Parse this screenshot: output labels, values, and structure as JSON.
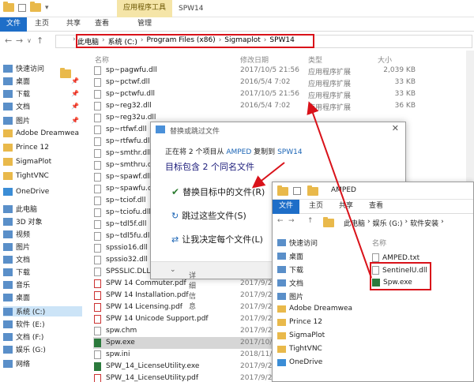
{
  "window": {
    "title": "SPW14",
    "context_tab_group": "应用程序工具",
    "ribbon_tabs": [
      "文件",
      "主页",
      "共享",
      "查看",
      "管理"
    ]
  },
  "address": {
    "crumbs": [
      "此电脑",
      "系统 (C:)",
      "Program Files (x86)",
      "Sigmaplot",
      "SPW14"
    ],
    "highlight_color": "#d9121a"
  },
  "columns": {
    "name": "名称",
    "date": "修改日期",
    "type": "类型",
    "size": "大小"
  },
  "sidebar": [
    {
      "label": "快速访问",
      "icon": "star-icon",
      "pinned": false
    },
    {
      "label": "桌面",
      "icon": "desktop-icon",
      "pinned": true
    },
    {
      "label": "下载",
      "icon": "download-icon",
      "pinned": true
    },
    {
      "label": "文档",
      "icon": "document-icon",
      "pinned": true
    },
    {
      "label": "图片",
      "icon": "picture-icon",
      "pinned": true
    },
    {
      "label": "Adobe Dreamwea",
      "icon": "folder-icon",
      "pinned": false
    },
    {
      "label": "Prince 12",
      "icon": "folder-icon",
      "pinned": false
    },
    {
      "label": "SigmaPlot",
      "icon": "folder-icon",
      "pinned": false
    },
    {
      "label": "TightVNC",
      "icon": "folder-icon",
      "pinned": false
    },
    {
      "label": "OneDrive",
      "icon": "cloud-icon",
      "pinned": false
    },
    {
      "label": "此电脑",
      "icon": "computer-icon",
      "pinned": false
    },
    {
      "label": "3D 对象",
      "icon": "cube-icon",
      "pinned": false
    },
    {
      "label": "视频",
      "icon": "video-icon",
      "pinned": false
    },
    {
      "label": "图片",
      "icon": "picture-icon",
      "pinned": false
    },
    {
      "label": "文档",
      "icon": "document-icon",
      "pinned": false
    },
    {
      "label": "下载",
      "icon": "download-icon",
      "pinned": false
    },
    {
      "label": "音乐",
      "icon": "music-icon",
      "pinned": false
    },
    {
      "label": "桌面",
      "icon": "desktop-icon",
      "pinned": false
    },
    {
      "label": "系统 (C:)",
      "icon": "drive-icon",
      "pinned": false,
      "selected": true
    },
    {
      "label": "软件 (E:)",
      "icon": "drive-icon",
      "pinned": false
    },
    {
      "label": "文档 (F:)",
      "icon": "drive-icon",
      "pinned": false
    },
    {
      "label": "娱乐 (G:)",
      "icon": "drive-icon",
      "pinned": false
    },
    {
      "label": "网络",
      "icon": "network-icon",
      "pinned": false
    }
  ],
  "files": [
    {
      "name": "sp~pagwfu.dll",
      "date": "2017/10/5 21:56",
      "type": "应用程序扩展",
      "size": "2,039 KB"
    },
    {
      "name": "sp~pctwf.dll",
      "date": "2016/5/4 7:02",
      "type": "应用程序扩展",
      "size": "33 KB"
    },
    {
      "name": "sp~pctwfu.dll",
      "date": "2017/10/5 21:56",
      "type": "应用程序扩展",
      "size": "33 KB"
    },
    {
      "name": "sp~reg32.dll",
      "date": "2016/5/4 7:02",
      "type": "应用程序扩展",
      "size": "36 KB"
    },
    {
      "name": "sp~reg32u.dll",
      "date": "",
      "type": "",
      "size": ""
    },
    {
      "name": "sp~rtfwf.dll",
      "date": "",
      "type": "",
      "size": ""
    },
    {
      "name": "sp~rtfwfu.dll",
      "date": "",
      "type": "",
      "size": ""
    },
    {
      "name": "sp~smthr.dll",
      "date": "",
      "type": "",
      "size": ""
    },
    {
      "name": "sp~smthru.dll",
      "date": "",
      "type": "",
      "size": ""
    },
    {
      "name": "sp~spawf.dll",
      "date": "",
      "type": "",
      "size": ""
    },
    {
      "name": "sp~spawfu.dll",
      "date": "",
      "type": "",
      "size": ""
    },
    {
      "name": "sp~tciof.dll",
      "date": "",
      "type": "",
      "size": ""
    },
    {
      "name": "sp~tciofu.dll",
      "date": "",
      "type": "",
      "size": ""
    },
    {
      "name": "sp~tdl5f.dll",
      "date": "",
      "type": "",
      "size": ""
    },
    {
      "name": "sp~tdl5fu.dll",
      "date": "",
      "type": "",
      "size": ""
    },
    {
      "name": "spssio16.dll",
      "date": "",
      "type": "",
      "size": ""
    },
    {
      "name": "spssio32.dll",
      "date": "",
      "type": "",
      "size": ""
    },
    {
      "name": "SPSSLIC.DLL",
      "date": "",
      "type": "",
      "size": ""
    },
    {
      "name": "SPW 14 Commuter.pdf",
      "date": "2017/9/2",
      "type": "",
      "size": ""
    },
    {
      "name": "SPW 14 Installation.pdf",
      "date": "2017/9/2",
      "type": "",
      "size": ""
    },
    {
      "name": "SPW 14 Licensing.pdf",
      "date": "2017/9/2",
      "type": "",
      "size": ""
    },
    {
      "name": "SPW 14 Unicode Support.pdf",
      "date": "2017/9/2",
      "type": "",
      "size": ""
    },
    {
      "name": "spw.chm",
      "date": "2017/9/2",
      "type": "",
      "size": ""
    },
    {
      "name": "Spw.exe",
      "date": "2017/10/",
      "type": "",
      "size": "",
      "selected": true
    },
    {
      "name": "spw.ini",
      "date": "2018/11/",
      "type": "",
      "size": ""
    },
    {
      "name": "SPW_14_LicenseUtility.exe",
      "date": "2017/9/2",
      "type": "",
      "size": ""
    },
    {
      "name": "SPW_14_LicenseUtility.pdf",
      "date": "2017/9/2",
      "type": "",
      "size": ""
    }
  ],
  "dialog": {
    "title": "替换或跳过文件",
    "status_prefix": "正在将 2 个项目从",
    "status_src": "AMPED",
    "status_mid": "复制到",
    "status_dst": "SPW14",
    "message": "目标包含 2 个同名文件",
    "options": [
      {
        "label": "替换目标中的文件(R)",
        "icon": "checkmark-icon"
      },
      {
        "label": "跳过这些文件(S)",
        "icon": "skip-icon"
      },
      {
        "label": "让我决定每个文件(L)",
        "icon": "decide-icon"
      }
    ],
    "details": "详细信息"
  },
  "window2": {
    "title": "AMPED",
    "ribbon_tabs": [
      "文件",
      "主页",
      "共享",
      "查看"
    ],
    "crumbs": [
      "此电脑",
      "娱乐 (G:)",
      "软件安装"
    ],
    "column_name": "名称",
    "sidebar": [
      "快速访问",
      "桌面",
      "下载",
      "文档",
      "图片",
      "Adobe Dreamwea",
      "Prince 12",
      "SigmaPlot",
      "TightVNC",
      "OneDrive"
    ],
    "files": [
      "AMPED.txt",
      "SentinelU.dll",
      "Spw.exe"
    ]
  }
}
